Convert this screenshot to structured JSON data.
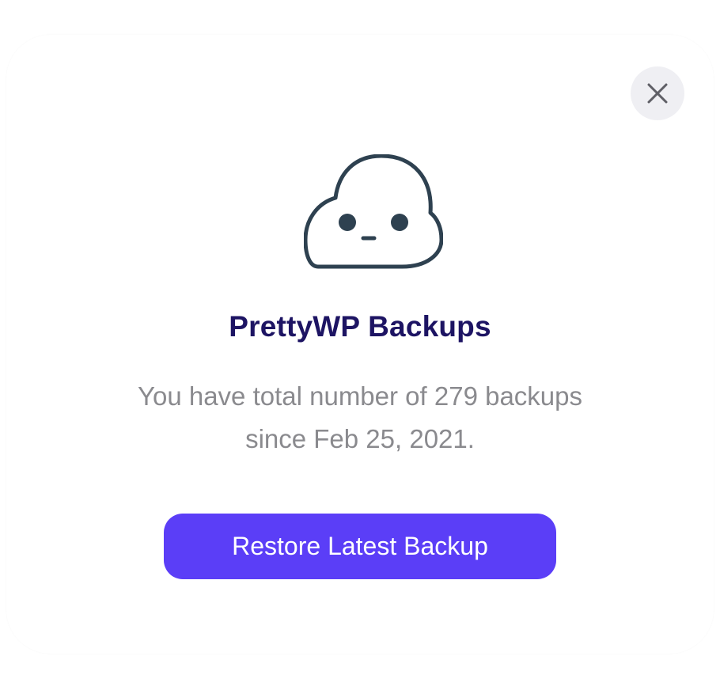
{
  "dialog": {
    "title": "PrettyWP Backups",
    "description_line1": "You have total number of 279 backups",
    "description_line2": "since Feb 25, 2021.",
    "restore_button_label": "Restore Latest Backup",
    "close_icon": "close-icon",
    "illustration_icon": "cloud-face-icon"
  },
  "colors": {
    "accent": "#5b3ef7",
    "title": "#1d1463",
    "text_muted": "#8a8a8e",
    "icon_stroke": "#2e4150",
    "close_bg": "#efeff3"
  }
}
